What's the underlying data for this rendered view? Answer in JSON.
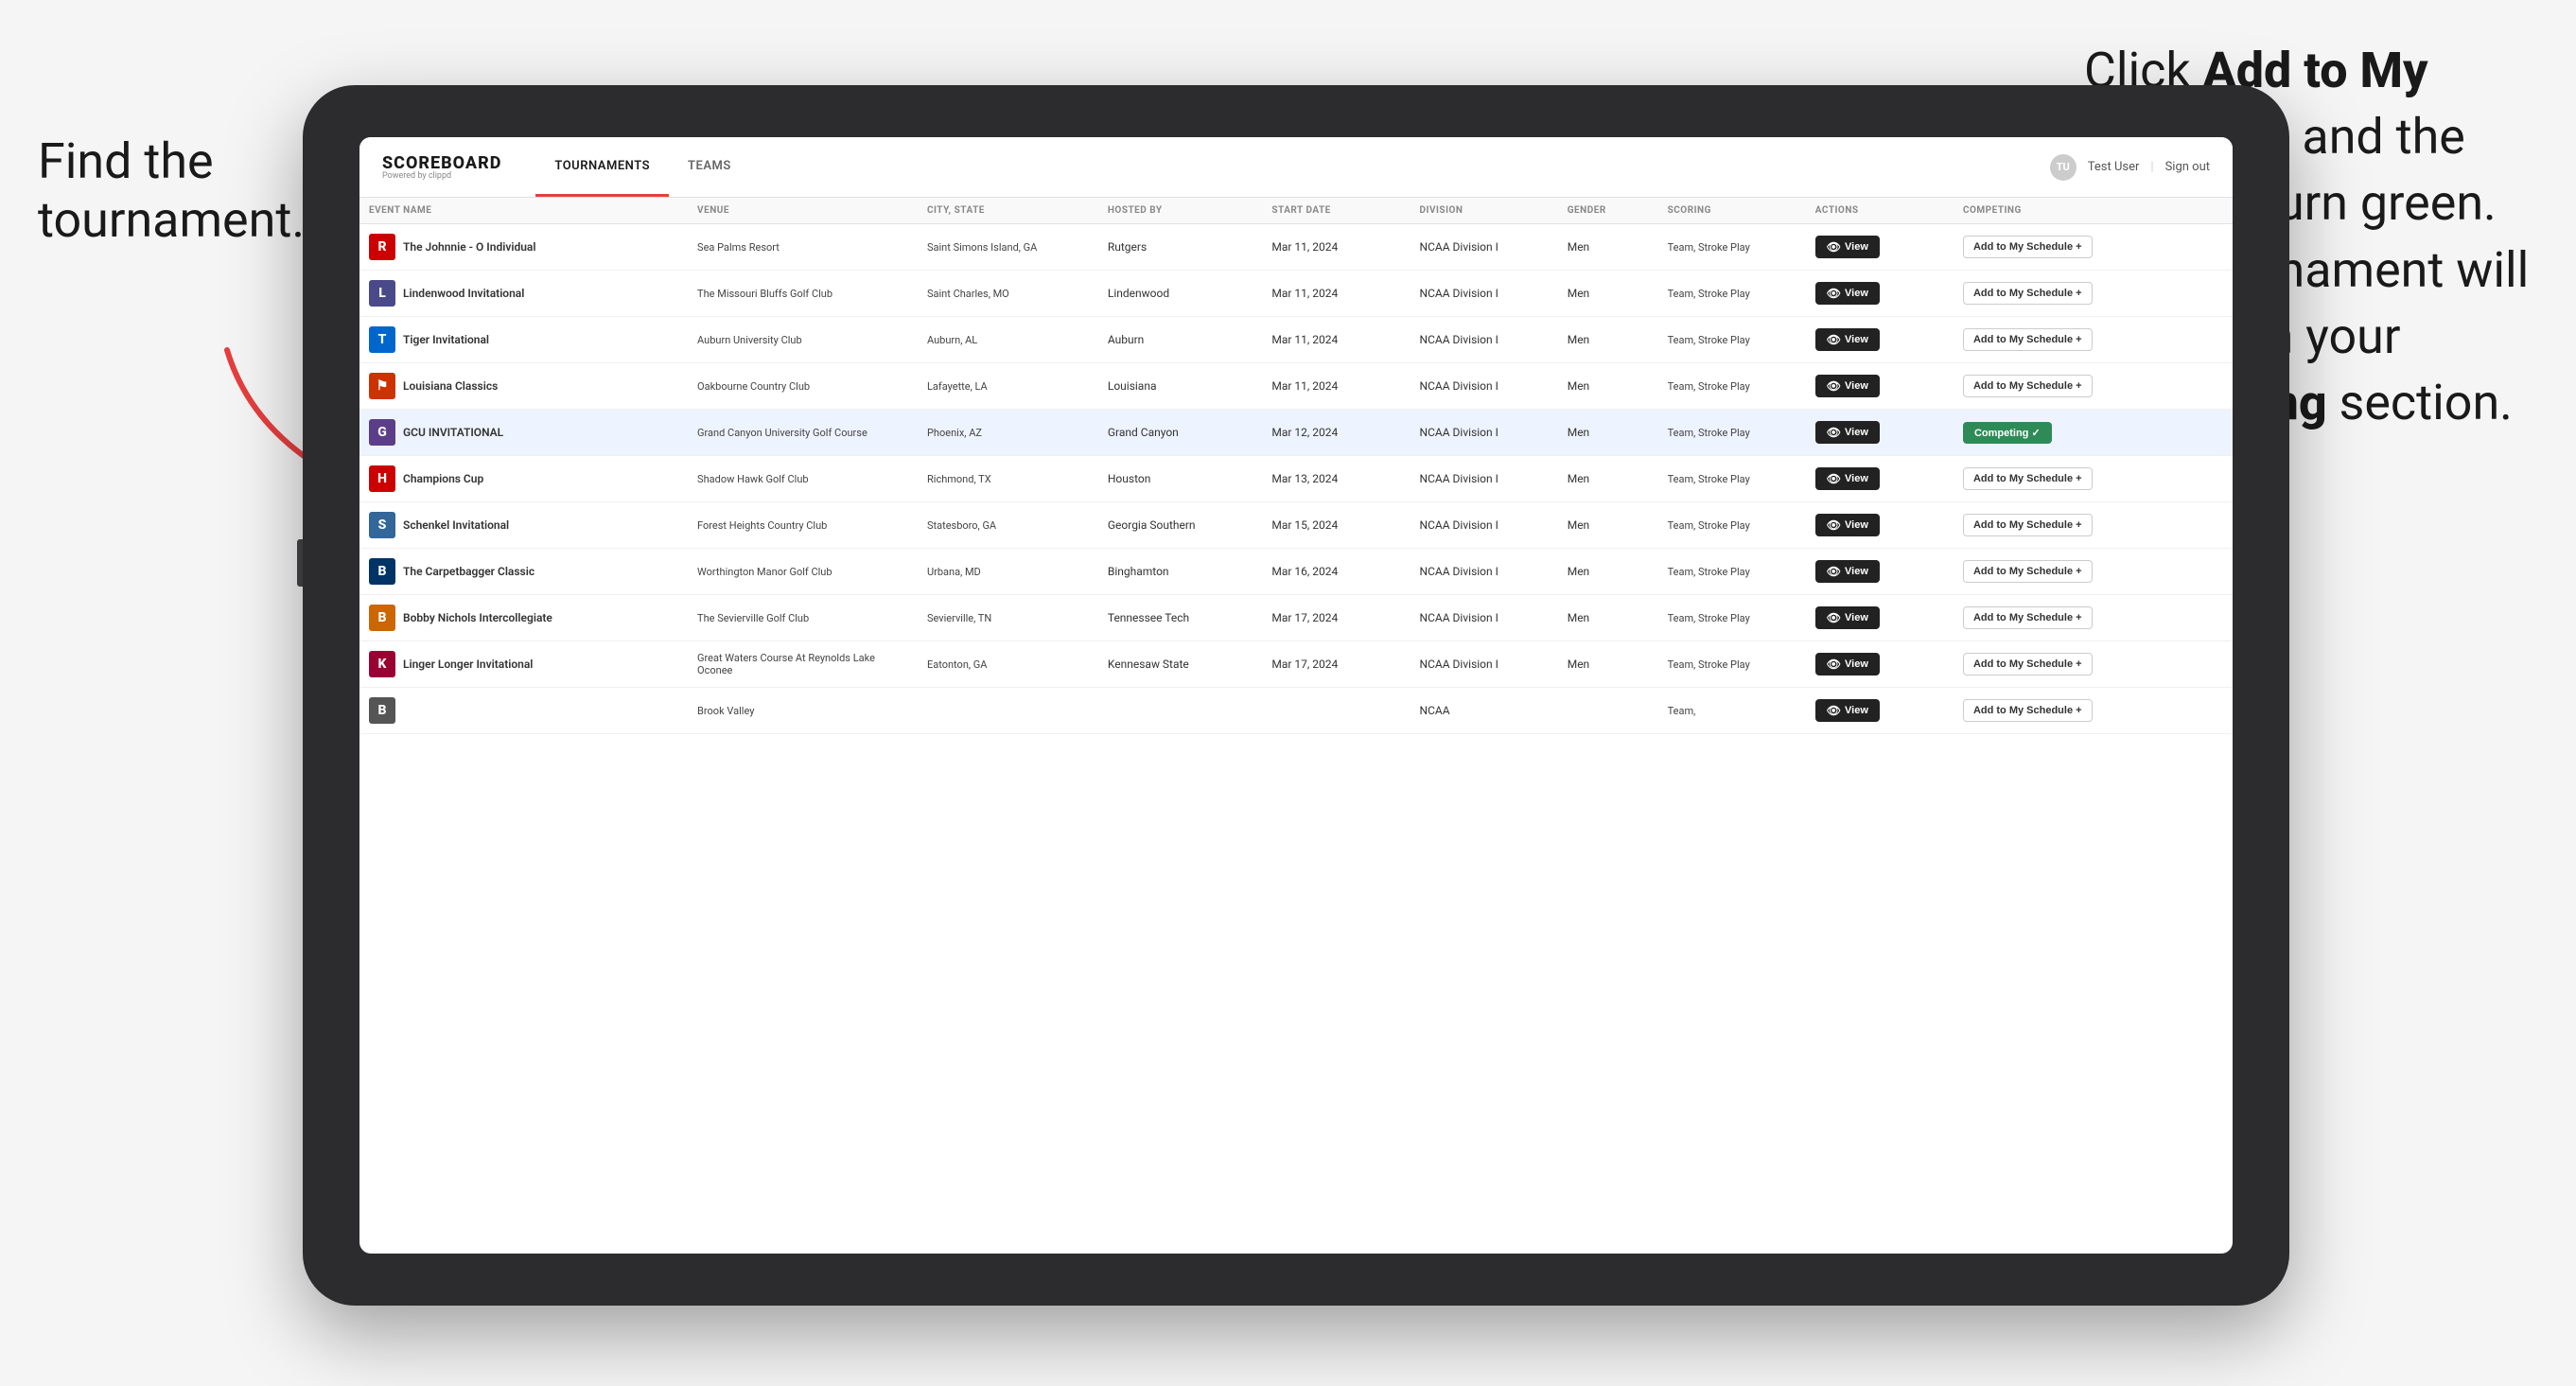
{
  "annotations": {
    "left": "Find the\ntournament.",
    "right_p1": "Click ",
    "right_bold1": "Add to My Schedule",
    "right_p2": " and the box will turn green. This tournament will now be in your ",
    "right_bold2": "Competing",
    "right_p3": " section."
  },
  "header": {
    "logo": "SCOREBOARD",
    "logo_sub": "Powered by clippd",
    "nav_tabs": [
      "TOURNAMENTS",
      "TEAMS"
    ],
    "active_tab": "TOURNAMENTS",
    "user": "Test User",
    "sign_out": "Sign out"
  },
  "table": {
    "columns": [
      "EVENT NAME",
      "VENUE",
      "CITY, STATE",
      "HOSTED BY",
      "START DATE",
      "DIVISION",
      "GENDER",
      "SCORING",
      "ACTIONS",
      "COMPETING"
    ],
    "rows": [
      {
        "logo_char": "R",
        "logo_color": "#cc0000",
        "event": "The Johnnie - O Individual",
        "venue": "Sea Palms Resort",
        "city": "Saint Simons Island, GA",
        "hosted": "Rutgers",
        "date": "Mar 11, 2024",
        "division": "NCAA Division I",
        "gender": "Men",
        "scoring": "Team, Stroke Play",
        "competing_status": "add"
      },
      {
        "logo_char": "L",
        "logo_color": "#4a4a8a",
        "event": "Lindenwood Invitational",
        "venue": "The Missouri Bluffs Golf Club",
        "city": "Saint Charles, MO",
        "hosted": "Lindenwood",
        "date": "Mar 11, 2024",
        "division": "NCAA Division I",
        "gender": "Men",
        "scoring": "Team, Stroke Play",
        "competing_status": "add"
      },
      {
        "logo_char": "T",
        "logo_color": "#0066cc",
        "event": "Tiger Invitational",
        "venue": "Auburn University Club",
        "city": "Auburn, AL",
        "hosted": "Auburn",
        "date": "Mar 11, 2024",
        "division": "NCAA Division I",
        "gender": "Men",
        "scoring": "Team, Stroke Play",
        "competing_status": "add"
      },
      {
        "logo_char": "⚑",
        "logo_color": "#cc3300",
        "event": "Louisiana Classics",
        "venue": "Oakbourne Country Club",
        "city": "Lafayette, LA",
        "hosted": "Louisiana",
        "date": "Mar 11, 2024",
        "division": "NCAA Division I",
        "gender": "Men",
        "scoring": "Team, Stroke Play",
        "competing_status": "add"
      },
      {
        "logo_char": "G",
        "logo_color": "#5c3d8a",
        "event": "GCU INVITATIONAL",
        "venue": "Grand Canyon University Golf Course",
        "city": "Phoenix, AZ",
        "hosted": "Grand Canyon",
        "date": "Mar 12, 2024",
        "division": "NCAA Division I",
        "gender": "Men",
        "scoring": "Team, Stroke Play",
        "competing_status": "competing",
        "highlight": true
      },
      {
        "logo_char": "H",
        "logo_color": "#cc0000",
        "event": "Champions Cup",
        "venue": "Shadow Hawk Golf Club",
        "city": "Richmond, TX",
        "hosted": "Houston",
        "date": "Mar 13, 2024",
        "division": "NCAA Division I",
        "gender": "Men",
        "scoring": "Team, Stroke Play",
        "competing_status": "add"
      },
      {
        "logo_char": "S",
        "logo_color": "#336699",
        "event": "Schenkel Invitational",
        "venue": "Forest Heights Country Club",
        "city": "Statesboro, GA",
        "hosted": "Georgia Southern",
        "date": "Mar 15, 2024",
        "division": "NCAA Division I",
        "gender": "Men",
        "scoring": "Team, Stroke Play",
        "competing_status": "add"
      },
      {
        "logo_char": "B",
        "logo_color": "#003366",
        "event": "The Carpetbagger Classic",
        "venue": "Worthington Manor Golf Club",
        "city": "Urbana, MD",
        "hosted": "Binghamton",
        "date": "Mar 16, 2024",
        "division": "NCAA Division I",
        "gender": "Men",
        "scoring": "Team, Stroke Play",
        "competing_status": "add"
      },
      {
        "logo_char": "B",
        "logo_color": "#cc6600",
        "event": "Bobby Nichols Intercollegiate",
        "venue": "The Sevierville Golf Club",
        "city": "Sevierville, TN",
        "hosted": "Tennessee Tech",
        "date": "Mar 17, 2024",
        "division": "NCAA Division I",
        "gender": "Men",
        "scoring": "Team, Stroke Play",
        "competing_status": "add"
      },
      {
        "logo_char": "K",
        "logo_color": "#990033",
        "event": "Linger Longer Invitational",
        "venue": "Great Waters Course At Reynolds Lake Oconee",
        "city": "Eatonton, GA",
        "hosted": "Kennesaw State",
        "date": "Mar 17, 2024",
        "division": "NCAA Division I",
        "gender": "Men",
        "scoring": "Team, Stroke Play",
        "competing_status": "add"
      },
      {
        "logo_char": "B",
        "logo_color": "#555",
        "event": "",
        "venue": "Brook Valley",
        "city": "",
        "hosted": "",
        "date": "",
        "division": "NCAA",
        "gender": "",
        "scoring": "Team,",
        "competing_status": "add"
      }
    ],
    "view_btn_label": "View",
    "add_btn_label": "Add to My Schedule +",
    "competing_btn_label": "Competing ✓"
  }
}
